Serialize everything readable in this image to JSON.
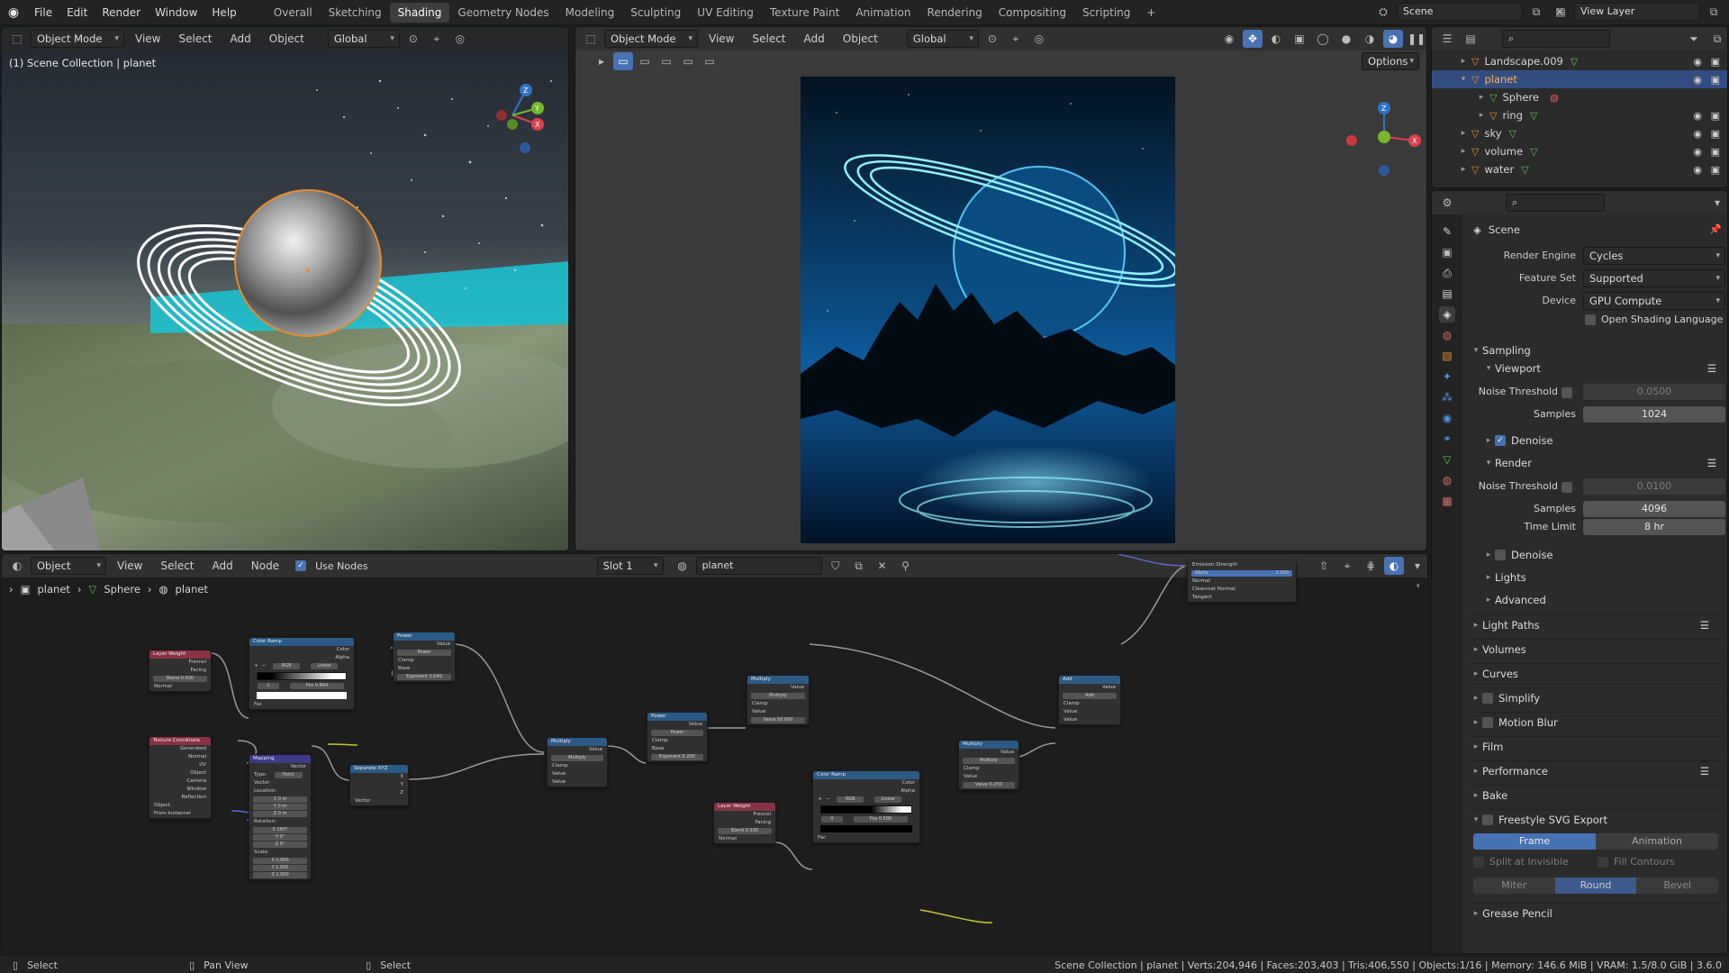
{
  "topbar": {
    "menus": [
      "File",
      "Edit",
      "Render",
      "Window",
      "Help"
    ],
    "workspaces": [
      "Overall",
      "Sketching",
      "Shading",
      "Geometry Nodes",
      "Modeling",
      "Sculpting",
      "UV Editing",
      "Texture Paint",
      "Animation",
      "Rendering",
      "Compositing",
      "Scripting"
    ],
    "active_workspace": "Shading",
    "add_tab": "+",
    "scene_name": "Scene",
    "view_layer": "View Layer"
  },
  "viewport_left": {
    "mode": "Object Mode",
    "menus": [
      "View",
      "Select",
      "Add",
      "Object"
    ],
    "orientation": "Global",
    "overlay_text": "(1) Scene Collection | planet"
  },
  "viewport_right": {
    "mode": "Object Mode",
    "menus": [
      "View",
      "Select",
      "Add",
      "Object"
    ],
    "orientation": "Global",
    "options_label": "Options"
  },
  "outliner": {
    "rows": [
      {
        "name": "Landscape.009",
        "indent": 1,
        "selected": false
      },
      {
        "name": "planet",
        "indent": 1,
        "selected": true
      },
      {
        "name": "Sphere",
        "indent": 2,
        "selected": false
      },
      {
        "name": "ring",
        "indent": 2,
        "selected": false
      },
      {
        "name": "sky",
        "indent": 1,
        "selected": false
      },
      {
        "name": "volume",
        "indent": 1,
        "selected": false
      },
      {
        "name": "water",
        "indent": 1,
        "selected": false
      }
    ]
  },
  "properties": {
    "context": "Scene",
    "render_engine_label": "Render Engine",
    "render_engine": "Cycles",
    "feature_set_label": "Feature Set",
    "feature_set": "Supported",
    "device_label": "Device",
    "device": "GPU Compute",
    "osl_label": "Open Shading Language",
    "sampling": "Sampling",
    "viewport": "Viewport",
    "noise_threshold_label": "Noise Threshold",
    "viewport_noise": "0.0500",
    "samples_label": "Samples",
    "viewport_samples": "1024",
    "denoise_label": "Denoise",
    "render": "Render",
    "render_noise": "0.0100",
    "render_samples": "4096",
    "time_limit_label": "Time Limit",
    "time_limit": "8 hr",
    "lights": "Lights",
    "advanced": "Advanced",
    "sections": [
      "Light Paths",
      "Volumes",
      "Curves",
      "Simplify",
      "Motion Blur",
      "Film",
      "Performance",
      "Bake",
      "Freestyle SVG Export"
    ],
    "frame_btn": "Frame",
    "animation_btn": "Animation",
    "split_invisible": "Split at Invisible",
    "fill_contours": "Fill Contours",
    "miter": "Miter",
    "round": "Round",
    "bevel": "Bevel",
    "grease_pencil": "Grease Pencil"
  },
  "node_editor": {
    "type": "Object",
    "menus": [
      "View",
      "Select",
      "Add",
      "Node"
    ],
    "use_nodes": "Use Nodes",
    "slot": "Slot 1",
    "material": "planet",
    "breadcrumb": [
      "planet",
      "Sphere",
      "planet"
    ]
  },
  "nodes": {
    "layer_weight": "Layer Weight",
    "fresnel": "Fresnel",
    "facing": "Facing",
    "blend": "Blend",
    "blend_val": "0.500",
    "normal": "Normal",
    "color_ramp": "Color Ramp",
    "color": "Color",
    "alpha": "Alpha",
    "rgb": "RGB",
    "linear": "Linear",
    "pos": "Pos",
    "pos1": "0.864",
    "pos2": "0.586",
    "idx": "1",
    "idx2": "0",
    "fac": "Fac",
    "power": "Power",
    "value": "Value",
    "clamp": "Clamp",
    "base": "Base",
    "exponent": "Exponent",
    "exp1": "3.040",
    "exp2": "5.200",
    "tex_coord": "Texture Coordinate",
    "generated": "Generated",
    "uv": "UV",
    "object": "Object",
    "camera": "Camera",
    "window": "Window",
    "reflection": "Reflection",
    "object_field": "Object",
    "from_instancer": "From Instancer",
    "mapping": "Mapping",
    "vector": "Vector",
    "type": "Type:",
    "point": "Point",
    "location": "Location:",
    "rotation": "Rotation:",
    "scale": "Scale:",
    "x": "X",
    "y": "Y",
    "z": "Z",
    "m0": "0 m",
    "deg0": "0°",
    "deg180": "180°",
    "one": "1.000",
    "separate_xyz": "Separate XYZ",
    "multiply": "Multiply",
    "mult_val": "50.000",
    "mult_val2": "0.250",
    "add": "Add",
    "emission_strength": "Emission Strength",
    "alpha_label": "Alpha",
    "alpha_val": "1.000",
    "clearcoat_normal": "Clearcoat Normal",
    "tangent": "Tangent"
  },
  "statusbar": {
    "left": [
      {
        "k": "Select"
      },
      {
        "k": "Pan View"
      },
      {
        "k": "Select"
      }
    ],
    "right": "Scene Collection | planet | Verts:204,946 | Faces:203,403 | Tris:406,550 | Objects:1/16 | Memory: 146.6 MiB | VRAM: 1.5/8.0 GiB | 3.6.0"
  }
}
